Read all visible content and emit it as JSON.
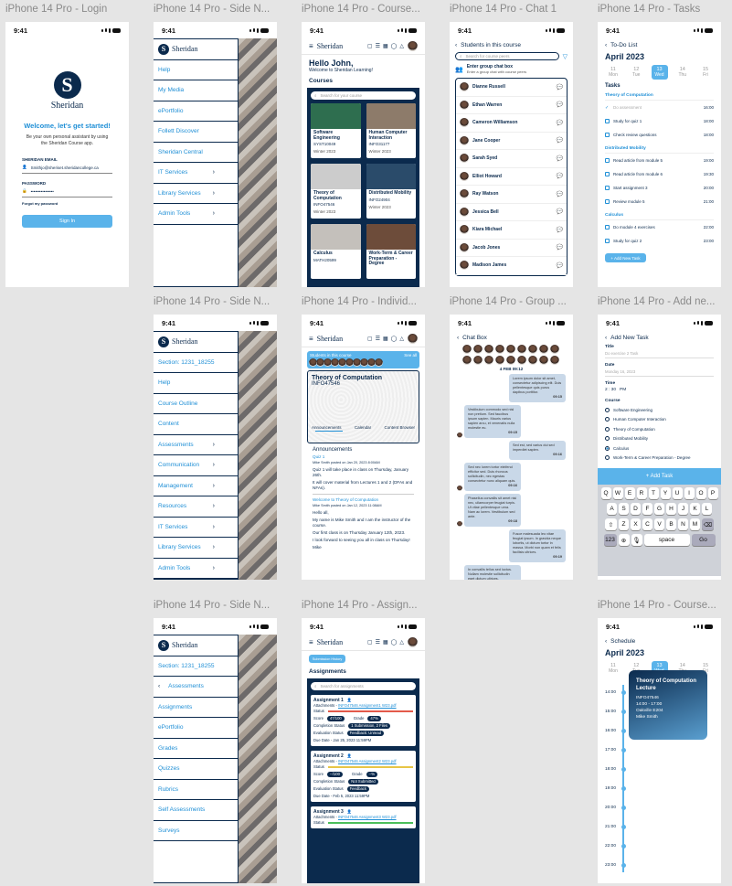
{
  "frames": [
    "iPhone 14 Pro - Login",
    "iPhone 14 Pro - Side N...",
    "iPhone 14 Pro - Course...",
    "iPhone 14 Pro - Chat 1",
    "iPhone 14 Pro - Tasks",
    "iPhone 14 Pro - Side N...",
    "iPhone 14 Pro - Individ...",
    "iPhone 14 Pro - Group ...",
    "iPhone 14 Pro - Add ne...",
    "iPhone 14 Pro - Side N...",
    "iPhone 14 Pro - Assign...",
    "iPhone 14 Pro - Course..."
  ],
  "time": "9:41",
  "brand": "Sheridan",
  "login": {
    "welcome": "Welcome, let's get started!",
    "sub": "Be your own personal assistant by using the Sheridan Course app.",
    "email_label": "SHERIDAN EMAIL",
    "email_value": "Smithjo@sheriset.sheridancollege.ca",
    "password_label": "PASSWORD",
    "password_value": "••••••••••••••••",
    "forgot": "Forgot my password",
    "signin": "Sign In"
  },
  "menu1": [
    "Help",
    "My Media",
    "ePortfolio",
    "Follett Discover",
    "Sheridan Central",
    "IT Services",
    "Library Services",
    "Admin Tools"
  ],
  "menu1_chev": [
    false,
    false,
    false,
    false,
    false,
    true,
    true,
    true
  ],
  "menu2": [
    "Section: 1231_18255",
    "Help",
    "Course Outline",
    "Content",
    "Assessments",
    "Communication",
    "Management",
    "Resources",
    "IT Services",
    "Library Services",
    "Admin Tools"
  ],
  "menu2_chev": [
    false,
    false,
    false,
    false,
    true,
    true,
    true,
    true,
    true,
    true,
    true
  ],
  "menu3_section": "Section: 1231_18255",
  "menu3_back": "Assessments",
  "menu3": [
    "Assignments",
    "ePortfolio",
    "Grades",
    "Quizzes",
    "Rubrics",
    "Self Assessments",
    "Surveys"
  ],
  "courses": {
    "hello": "Hello John,",
    "welcome": "Welcome to Sheridan Learning!",
    "title": "Courses",
    "search": "Search for your course",
    "items": [
      {
        "name": "Software Engineering",
        "code": "SYST10049",
        "term": "Winter 2023"
      },
      {
        "name": "Human Computer Interaction",
        "code": "INFO31177",
        "term": "Winter 2023"
      },
      {
        "name": "Theory of Computation",
        "code": "INFO47546",
        "term": "Winter 2023"
      },
      {
        "name": "Distributed Mobility",
        "code": "INFO24904",
        "term": "Winter 2023"
      },
      {
        "name": "Calculus",
        "code": "MATH20599",
        "term": ""
      },
      {
        "name": "Work-Term & Career Preparation - Degree",
        "code": "",
        "term": ""
      }
    ]
  },
  "chat1": {
    "title": "Students in this course",
    "search": "Search for course peers",
    "group": "Enter group chat box",
    "group_sub": "Enter a group chat with course peers",
    "people": [
      "Dianne Russell",
      "Ethan Warren",
      "Cameron Williamson",
      "Jane Cooper",
      "Sarah Syed",
      "Elliot Howard",
      "Ray Watson",
      "Jessica Bell",
      "Kiara Michael",
      "Jacob Jones",
      "Madison James"
    ]
  },
  "tasks": {
    "title": "To-Do List",
    "month": "April 2023",
    "days": [
      {
        "n": "11",
        "d": "Mon"
      },
      {
        "n": "12",
        "d": "Tue"
      },
      {
        "n": "13",
        "d": "Wed"
      },
      {
        "n": "14",
        "d": "Thu"
      },
      {
        "n": "15",
        "d": "Fri"
      }
    ],
    "heading": "Tasks",
    "groups": [
      {
        "name": "Theory of Computation",
        "items": [
          {
            "t": "Do assessment",
            "time": "16:00",
            "done": true
          },
          {
            "t": "Study for quiz 1",
            "time": "18:00",
            "done": false
          },
          {
            "t": "Check review questions",
            "time": "18:00",
            "done": false
          }
        ]
      },
      {
        "name": "Distributed Mobility",
        "items": [
          {
            "t": "Read article from module 5",
            "time": "19:00",
            "done": false
          },
          {
            "t": "Read article from module 6",
            "time": "19:30",
            "done": false
          },
          {
            "t": "Start assignment 3",
            "time": "20:00",
            "done": false
          },
          {
            "t": "Review module 5",
            "time": "21:00",
            "done": false
          }
        ]
      },
      {
        "name": "Calculus",
        "items": [
          {
            "t": "Do module 4 exercises",
            "time": "22:00",
            "done": false
          },
          {
            "t": "Study for quiz 2",
            "time": "23:00",
            "done": false
          }
        ]
      }
    ],
    "add": "+ Add New Task"
  },
  "indiv": {
    "banner": "Students in this course",
    "see": "See all",
    "course": "Theory of Computation",
    "code": "INFO47546",
    "tabs": [
      "Announcements",
      "Calendar",
      "Content Browser"
    ],
    "heading": "Announcements",
    "a1_title": "Quiz 1",
    "a1_meta": "Mike Smith posted on Jan 20, 2023 8:00AM",
    "a1_body": "Quiz 1 will take place in class on Thursday, January 26th.",
    "a1_body2": "It will cover material from Lectures 1 and 2 (DFAs and NFAs).",
    "a2_title": "Welcome to Theory of Computation",
    "a2_meta": "Mike Smith posted on Jan 12, 2023 11:08AM",
    "a2_body": "Hello all,",
    "a2_body2": "My name is Mike Smith and I am the instructor of the course.",
    "a2_body3": "Our first class is on Thursday January 12th, 2023.",
    "a2_body4": "I look forward to seeing you all in class on Thursday!",
    "a2_sign": "Mike"
  },
  "group": {
    "title": "Chat Box",
    "date": "4 FEB 09:12",
    "msgs": [
      {
        "t": "Lorem ipsum dolor sit amet, consectetur adipiscing elit. Duis pellentesque quis purus dapibus porttitor.",
        "time": "09:15",
        "me": true
      },
      {
        "t": "Vestibulum commodo sed nisl non pretium. Sed faucibus ipsum sapien. Mauris varius sapien arcu, et venenatis nulla molestie eu.",
        "time": "09:15",
        "me": false
      },
      {
        "t": "Sed est, sed varius dui sed imperdiet sapien.",
        "time": "09:16",
        "me": true
      },
      {
        "t": "Sed nec lorem tortor eleifend efficitur sed. Duis rhoncus sollicitudin, nec egestas consectetur nunc aliquam quis.",
        "time": "09:16",
        "me": false
      },
      {
        "t": "Phasellus convallis sit amet nisi nec, ullamcorper feugiat turpis. Ut vitae pellentesque urna. Nam ac lorem. Vestibulum sed ante.",
        "time": "09:18",
        "me": false
      },
      {
        "t": "Fusce malesuada leo vitae feugiat ipsum. In gravida neque lobortis, ut dictum tortor in massa. Morbi non quam et felis facilisis ultrices.",
        "time": "09:19",
        "me": true
      },
      {
        "t": "In convallis tellus sed luctus. Nullam molestie sollicitudin eget dictum ultrices.",
        "time": "09:20",
        "me": false
      },
      {
        "t": "Praesent dapibus porttitor elit, ac ullamcorper tortor hendrerit in. Quisque id dolor non ex molestie congue.",
        "time": "09:21",
        "me": false
      },
      {
        "t": "Etiam eu commodo est. Aenean et lectus tellus euismod sapien. Nunc dictum mauris ac ipsum. Integer a condimentum ante.",
        "time": "09:21",
        "me": true
      }
    ]
  },
  "addtask": {
    "title": "Add New Task",
    "title_label": "Title",
    "title_ph": "Do exercise 2 Task",
    "date_label": "Date",
    "date_ph": "Monday 16, 2023",
    "time_label": "Time",
    "time_val": "2 : 30",
    "ampm": "PM",
    "course_label": "Course",
    "courses": [
      "Software Engineering",
      "Human Computer Interaction",
      "Theory of Computation",
      "Distributed Mobility",
      "Calculus",
      "Work-Term & Career Preparation - Degree"
    ],
    "selected": 4,
    "add": "+ Add Task",
    "kb_row1": [
      "Q",
      "W",
      "E",
      "R",
      "T",
      "Y",
      "U",
      "I",
      "O",
      "P"
    ],
    "kb_row2": [
      "A",
      "S",
      "D",
      "F",
      "G",
      "H",
      "J",
      "K",
      "L"
    ],
    "kb_row3": [
      "Z",
      "X",
      "C",
      "V",
      "B",
      "N",
      "M"
    ],
    "kb_num": "123",
    "kb_space": "space",
    "kb_go": "Go"
  },
  "assign": {
    "tag": "Submission History",
    "title": "Assignments",
    "search": "Search for assignments",
    "items": [
      {
        "name": "Assignment 1",
        "file": "INFO47546 Assignment1 W23.pdf",
        "status": "Status",
        "bar": "#e35a4a",
        "score": "47/100",
        "grade": "47%",
        "completion": "1 Submission, 2 Files",
        "evaluation": "Feedback: Unread",
        "due": "Due Date - Jan 25, 2023 11:59PM"
      },
      {
        "name": "Assignment 2",
        "file": "INFO47546 Assignment2 W23.pdf",
        "status": "Status",
        "bar": "#e7c546",
        "score": "--/100",
        "grade": "--%",
        "completion": "Not Submitted",
        "evaluation": "Feedback",
        "due": "Due Date - Feb 5, 2023 11:59PM"
      },
      {
        "name": "Assignment 3",
        "file": "INFO47546 Assignment3 W23.pdf",
        "status": "Status",
        "bar": "#4bbf5a",
        "score": "",
        "grade": "",
        "completion": "",
        "evaluation": "",
        "due": ""
      }
    ],
    "labels": {
      "attach": "Attachments -",
      "score": "Score",
      "grade": "Grade",
      "completion": "Completion Status",
      "evaluation": "Evaluation Status"
    }
  },
  "schedule": {
    "title": "Schedule",
    "month": "April 2023",
    "days": [
      {
        "n": "11",
        "d": "Mon"
      },
      {
        "n": "12",
        "d": "Tue"
      },
      {
        "n": "13",
        "d": "Wed"
      },
      {
        "n": "14",
        "d": "Thu"
      },
      {
        "n": "15",
        "d": "Fri"
      }
    ],
    "hours": [
      "14:00",
      "15:00",
      "16:00",
      "17:00",
      "18:00",
      "19:00",
      "20:00",
      "21:00",
      "22:00",
      "23:00"
    ],
    "event": {
      "title": "Theory of Computation Lecture",
      "code": "INFO47546",
      "time": "14:00 - 17:00",
      "room": "Oakville E204",
      "prof": "Mike Smith"
    }
  },
  "colors": {
    "navy": "#0b2a4d",
    "accent": "#1f8fd6",
    "button": "#5ab3ea",
    "canvas": "#e5e5e5"
  }
}
